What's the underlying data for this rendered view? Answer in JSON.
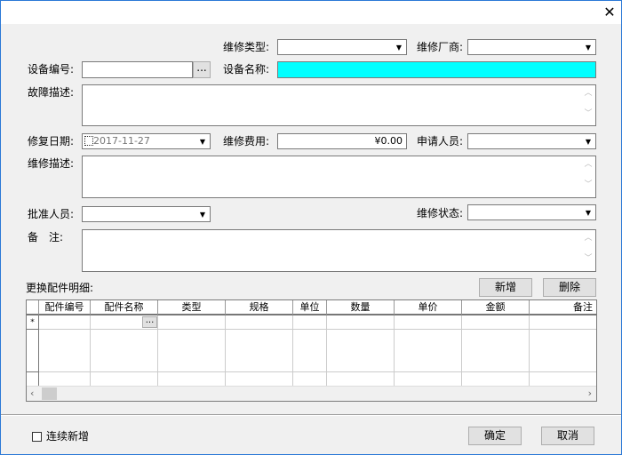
{
  "window": {
    "close": "✕"
  },
  "form": {
    "repair_type_label": "维修类型:",
    "repair_type": "",
    "vendor_label": "维修厂商:",
    "vendor": "",
    "device_no_label": "设备编号:",
    "device_no": "",
    "browse": "...",
    "device_name_label": "设备名称:",
    "device_name": "",
    "fault_label": "故障描述:",
    "fault": "",
    "repair_date_label": "修复日期:",
    "repair_date": "2017-11-27",
    "cost_label": "维修费用:",
    "cost": "¥0.00",
    "applicant_label": "申请人员:",
    "applicant": "",
    "repair_desc_label": "维修描述:",
    "repair_desc": "",
    "approver_label": "批准人员:",
    "approver": "",
    "status_label": "维修状态:",
    "status": "",
    "remark_label": "备　注:",
    "remark": "",
    "accent_cyan": "#00ffff"
  },
  "parts": {
    "title": "更换配件明细:",
    "add": "新增",
    "delete": "删除",
    "columns": [
      "配件编号",
      "配件名称",
      "类型",
      "规格",
      "单位",
      "数量",
      "单价",
      "金额",
      "备注"
    ],
    "new_row_marker": "*",
    "cell_browse": "..."
  },
  "footer": {
    "continuous_add": "连续新增",
    "ok": "确定",
    "cancel": "取消"
  }
}
